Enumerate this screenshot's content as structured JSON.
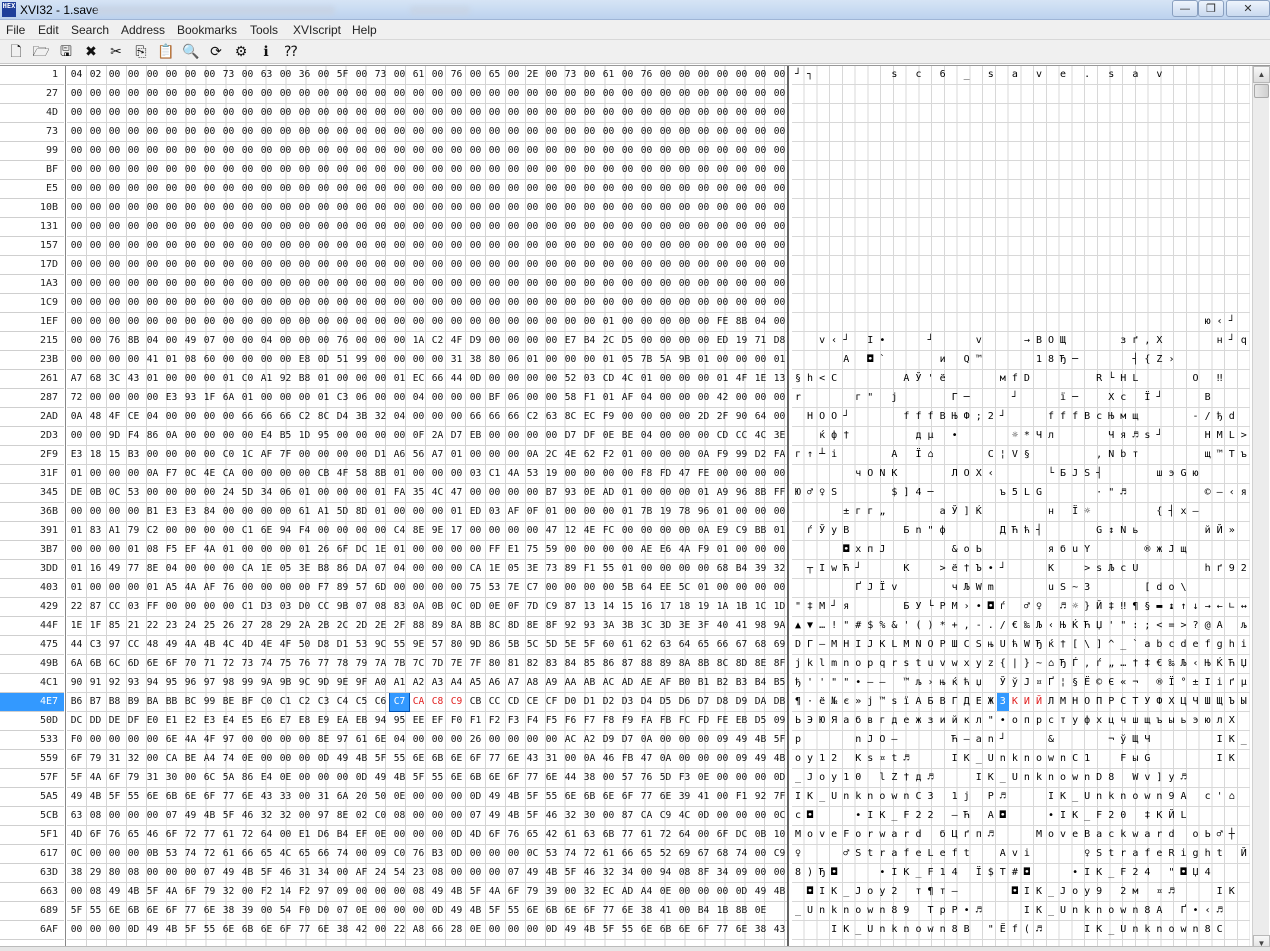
{
  "window": {
    "title": "XVI32 - 1.save",
    "icon_text": "HEX",
    "btn_minimize": "—",
    "btn_maximize": "❐",
    "btn_close": "✕"
  },
  "menu": {
    "items": [
      "File",
      "Edit",
      "Search",
      "Address",
      "Bookmarks",
      "Tools",
      "XVIscript",
      "Help"
    ]
  },
  "toolbar": {
    "buttons": [
      {
        "name": "new-icon",
        "glyph": "🗋"
      },
      {
        "name": "open-icon",
        "glyph": "🗁"
      },
      {
        "name": "save-icon",
        "glyph": "🖫"
      },
      {
        "name": "close-file-icon",
        "glyph": "✖"
      },
      {
        "name": "cut-icon",
        "glyph": "✂"
      },
      {
        "name": "copy-icon",
        "glyph": "⎘"
      },
      {
        "name": "paste-icon",
        "glyph": "📋"
      },
      {
        "name": "find-icon",
        "glyph": "🔍"
      },
      {
        "name": "replace-icon",
        "glyph": "⟳"
      },
      {
        "name": "settings-icon",
        "glyph": "⚙"
      },
      {
        "name": "info-icon",
        "glyph": "ℹ"
      },
      {
        "name": "context-help-icon",
        "glyph": "⁇"
      }
    ]
  },
  "editor": {
    "bytes_per_row": 38,
    "selected_address": "4E7",
    "cursor_col": 17,
    "red_cols": [
      18,
      19,
      20
    ],
    "rows": [
      {
        "addr": "1",
        "hex": "04 02 00 00 00 00 00 00 73 00 63 00 36 00 5F 00 73 00 61 00 76 00 65 00 2E 00 73 00 61 00 76 00 00 00 00 00 00 00",
        "text": "┘┐      s c 6 _ s a v e . s a v        "
      },
      {
        "addr": "27",
        "hex": "00 00 00 00 00 00 00 00 00 00 00 00 00 00 00 00 00 00 00 00 00 00 00 00 00 00 00 00 00 00 00 00 00 00 00 00 00 00",
        "text": ""
      },
      {
        "addr": "4D",
        "hex": "00 00 00 00 00 00 00 00 00 00 00 00 00 00 00 00 00 00 00 00 00 00 00 00 00 00 00 00 00 00 00 00 00 00 00 00 00 00",
        "text": ""
      },
      {
        "addr": "73",
        "hex": "00 00 00 00 00 00 00 00 00 00 00 00 00 00 00 00 00 00 00 00 00 00 00 00 00 00 00 00 00 00 00 00 00 00 00 00 00 00",
        "text": ""
      },
      {
        "addr": "99",
        "hex": "00 00 00 00 00 00 00 00 00 00 00 00 00 00 00 00 00 00 00 00 00 00 00 00 00 00 00 00 00 00 00 00 00 00 00 00 00 00",
        "text": ""
      },
      {
        "addr": "BF",
        "hex": "00 00 00 00 00 00 00 00 00 00 00 00 00 00 00 00 00 00 00 00 00 00 00 00 00 00 00 00 00 00 00 00 00 00 00 00 00 00",
        "text": ""
      },
      {
        "addr": "E5",
        "hex": "00 00 00 00 00 00 00 00 00 00 00 00 00 00 00 00 00 00 00 00 00 00 00 00 00 00 00 00 00 00 00 00 00 00 00 00 00 00",
        "text": ""
      },
      {
        "addr": "10B",
        "hex": "00 00 00 00 00 00 00 00 00 00 00 00 00 00 00 00 00 00 00 00 00 00 00 00 00 00 00 00 00 00 00 00 00 00 00 00 00 00",
        "text": ""
      },
      {
        "addr": "131",
        "hex": "00 00 00 00 00 00 00 00 00 00 00 00 00 00 00 00 00 00 00 00 00 00 00 00 00 00 00 00 00 00 00 00 00 00 00 00 00 00",
        "text": ""
      },
      {
        "addr": "157",
        "hex": "00 00 00 00 00 00 00 00 00 00 00 00 00 00 00 00 00 00 00 00 00 00 00 00 00 00 00 00 00 00 00 00 00 00 00 00 00 00",
        "text": ""
      },
      {
        "addr": "17D",
        "hex": "00 00 00 00 00 00 00 00 00 00 00 00 00 00 00 00 00 00 00 00 00 00 00 00 00 00 00 00 00 00 00 00 00 00 00 00 00 00",
        "text": ""
      },
      {
        "addr": "1A3",
        "hex": "00 00 00 00 00 00 00 00 00 00 00 00 00 00 00 00 00 00 00 00 00 00 00 00 00 00 00 00 00 00 00 00 00 00 00 00 00 00",
        "text": ""
      },
      {
        "addr": "1C9",
        "hex": "00 00 00 00 00 00 00 00 00 00 00 00 00 00 00 00 00 00 00 00 00 00 00 00 00 00 00 00 00 00 00 00 00 00 00 00 00 00",
        "text": ""
      },
      {
        "addr": "1EF",
        "hex": "00 00 00 00 00 00 00 00 00 00 00 00 00 00 00 00 00 00 00 00 00 00 00 00 00 00 00 00 01 00 00 00 00 00 FE 8B 04 00",
        "text": "                                  ю‹┘ "
      },
      {
        "addr": "215",
        "hex": "00 00 76 8B 04 00 49 07 00 00 04 00 00 00 76 00 00 00 1A C2 4F D9 00 00 00 00 E7 B4 2C D5 00 00 00 00 ED 19 71 D8",
        "text": "  v‹┘ I•   ┘   v   →ВОЩ    зґ,Х    н┘qШ"
      },
      {
        "addr": "23B",
        "hex": "00 00 00 00 41 01 08 60 00 00 00 00 E8 0D 51 99 00 00 00 00 31 38 80 06 01 00 00 00 01 05 7B 5A 9B 01 00 00 00 01",
        "text": "    А ◘`    и Q™    18Ђ─    ┤{Z›    "
      },
      {
        "addr": "261",
        "hex": "A7 68 3C 43 01 00 00 00 01 C0 A1 92 B8 01 00 00 00 01 EC 66 44 0D 00 00 00 00 52 03 CD 4C 01 00 00 00 01 4F 1E 13",
        "text": "§h<C     АЎ'ё    мfD     R└HL    О ‼"
      },
      {
        "addr": "287",
        "hex": "72 00 00 00 00 E3 93 1F 6A 01 00 00 00 01 C3 06 00 00 04 00 00 00 BF 06 00 00 58 F1 01 AF 04 00 00 00 42 00 00 00",
        "text": "r    г\" j    Г─   ┘   ї─  Xс Ї┘   В   "
      },
      {
        "addr": "2AD",
        "hex": "0A 48 4F CE 04 00 00 00 00 66 66 66 C2 8C D4 3B 32 04 00 00 00 66 66 66 C2 63 8C EC F9 00 00 00 00 2D 2F 90 64 00",
        "text": " HOО┘    fffВЊФ;2┘   fffВcЊмщ    -/ђd "
      },
      {
        "addr": "2D3",
        "hex": "00 00 9D F4 86 0A 00 00 00 00 E4 B5 1D 95 00 00 00 00 0F 2A D7 EB 00 00 00 00 D7 DF 0E BE 04 00 00 00 CD CC 4C 3E",
        "text": "  ќф†     дµ •    ☼*Чл    Чя♬ѕ┘   НМL>"
      },
      {
        "addr": "2F9",
        "hex": "E3 18 15 B3 00 00 00 00 C0 1C AF 7F 00 00 00 00 D1 A6 56 A7 01 00 00 00 0A 2C 4E 62 F2 01 00 00 00 0A F9 99 D2 FA",
        "text": "г↑┴і    А Ї⌂    С¦V§     ,Nbт     щ™Тъ"
      },
      {
        "addr": "31F",
        "hex": "01 00 00 00 0A F7 0C 4E CA 00 00 00 00 CB 4F 58 8B 01 00 00 00 03 C1 4A 53 19 00 00 00 00 F8 FD 47 FE 00 00 00 00",
        "text": "     чONК    ЛОХ‹    └БJS┤    шэGю    "
      },
      {
        "addr": "345",
        "hex": "DE 0B 0C 53 00 00 00 00 24 5D 34 06 01 00 00 00 01 FA 35 4C 47 00 00 00 00 B7 93 0E AD 01 00 00 00 01 A9 96 8B FF",
        "text": "Ю♂♀S    $]4─     ъ5LG    ·\"♬­     ©–‹я"
      },
      {
        "addr": "36B",
        "hex": "00 00 00 00 B1 E3 E3 84 00 00 00 00 61 A1 5D 8D 01 00 00 00 01 ED 03 AF 0F 01 00 00 00 01 7B 19 78 96 01 00 00 00",
        "text": "    ±гг„    аЎ]Ќ     н Ї☼     {┤x–    "
      },
      {
        "addr": "391",
        "hex": "01 83 A1 79 C2 00 00 00 00 C1 6E 94 F4 00 00 00 00 C4 8E 9E 17 00 00 00 00 47 12 4E FC 00 00 00 00 0A E9 C9 BB 01",
        "text": " ѓЎуВ    Бn\"ф    ДЋћ┤    G↕Nь     йЙ» "
      },
      {
        "addr": "3B7",
        "hex": "00 00 00 01 08 F5 EF 4A 01 00 00 00 01 26 6F DC 1E 01 00 00 00 00 FF E1 75 59 00 00 00 00 AE E6 4A F9 01 00 00 00",
        "text": "    ◘хпJ     &oЬ     ябuY    ®жJщ    "
      },
      {
        "addr": "3DD",
        "hex": "01 16 49 77 8E 04 00 00 00 CA 1E 05 3E B8 86 DA 07 04 00 00 00 CA 1E 05 3E 73 89 F1 55 01 00 00 00 00 68 B4 39 32",
        "text": " ┬IwЋ┘   К  >ё†Ъ•┘   К  >sЉсU     hґ92"
      },
      {
        "addr": "403",
        "hex": "01 00 00 00 01 A5 4A AF 76 00 00 00 00 F7 89 57 6D 00 00 00 00 75 53 7E C7 00 00 00 00 5B 64 EE 5C 01 00 00 00 00",
        "text": "     ҐJЇv    чЉWm    uS~З    [dо\\     "
      },
      {
        "addr": "429",
        "hex": "22 87 CC 03 FF 00 00 00 00 C1 D3 03 D0 CC 9B 07 08 83 0A 0B 0C 0D 0E 0F 7D C9 87 13 14 15 16 17 18 19 1A 1B 1C 1D",
        "text": "\"‡М┘я    БУ└РМ›•◘ѓ ♂♀ ♬☼}Й‡‼¶§▬↨↑↓→←∟↔"
      },
      {
        "addr": "44F",
        "hex": "1E 1F 85 21 22 23 24 25 26 27 28 29 2A 2B 2C 2D 2E 2F 88 89 8A 8B 8C 8D 8E 8F 92 93 3A 3B 3C 3D 3E 3F 40 41 98 9A",
        "text": "▲▼…!\"#$%&'()*+,-./€‰Љ‹ЊЌЋЏ'\":;<=>?@A љ"
      },
      {
        "addr": "475",
        "hex": "44 C3 97 CC 48 49 4A 4B 4C 4D 4E 4F 50 D8 D1 53 9C 55 9E 57 80 9D 86 5B 5C 5D 5E 5F 60 61 62 63 64 65 66 67 68 69",
        "text": "DГ—МHIJKLMNOPШСSњUћWЂќ†[\\]^_`abcdefghi"
      },
      {
        "addr": "49B",
        "hex": "6A 6B 6C 6D 6E 6F 70 71 72 73 74 75 76 77 78 79 7A 7B 7C 7D 7E 7F 80 81 82 83 84 85 86 87 88 89 8A 8B 8C 8D 8E 8F",
        "text": "jklmnopqrstuvwxyz{|}~⌂ЂЃ‚ѓ„…†‡€‰Љ‹ЊЌЋЏ"
      },
      {
        "addr": "4C1",
        "hex": "90 91 92 93 94 95 96 97 98 99 9A 9B 9C 9D 9E 9F A0 A1 A2 A3 A4 A5 A6 A7 A8 A9 AA AB AC AD AE AF B0 B1 B2 B3 B4 B5",
        "text": "ђ''\"\"•–— ™љ›њќћџ ЎўЈ¤Ґ¦§Ё©Є«¬­®Ї°±Ііґµ"
      },
      {
        "addr": "4E7",
        "hex": "B6 B7 B8 B9 BA BB BC 99 BE BF C0 C1 C2 C3 C4 C5 C6 C7 CA C8 C9 CB CC CD CE CF D0 D1 D2 D3 D4 D5 D6 D7 D8 D9 DA DB",
        "text": "¶·ё№є»ј™ѕїАБВГДЕЖЗКИЙЛМНОПРСТУФХЦЧШЩЪЫ"
      },
      {
        "addr": "50D",
        "hex": "DC DD DE DF E0 E1 E2 E3 E4 E5 E6 E7 E8 E9 EA EB 94 95 EE EF F0 F1 F2 F3 F4 F5 F6 F7 F8 F9 FA FB FC FD FE EB D5 09",
        "text": "ЬЭЮЯабвгдежзийкл\"•опрстуфхцчшщъыьэюлХ "
      },
      {
        "addr": "533",
        "hex": "F0 00 00 00 00 6E 4A 4F 97 00 00 00 00 8E 97 61 6E 04 00 00 00 26 00 00 00 00 AC A2 D9 D7 0A 00 00 00 09 49 4B 5F 4A",
        "text": "р    nJO—    Ћ—an┘   &    ¬ўЩЧ     IK_J"
      },
      {
        "addr": "559",
        "hex": "6F 79 31 32 00 CA BE A4 74 0E 00 00 00 0D 49 4B 5F 55 6E 6B 6E 6F 77 6E 43 31 00 0A 46 FB 47 0A 00 00 00 09 49 4B",
        "text": "oy12 Кѕ¤t♬   IK_UnknownC1  FыG     IK"
      },
      {
        "addr": "57F",
        "hex": "5F 4A 6F 79 31 30 00 6C 5A 86 E4 0E 00 00 00 0D 49 4B 5F 55 6E 6B 6E 6F 77 6E 44 38 00 57 76 5D F3 0E 00 00 00 0D",
        "text": "_Joy10 lZ†д♬   IK_UnknownD8 Wv]у♬   "
      },
      {
        "addr": "5A5",
        "hex": "49 4B 5F 55 6E 6B 6E 6F 77 6E 43 33 00 31 6A 20 50 0E 00 00 00 0D 49 4B 5F 55 6E 6B 6E 6F 77 6E 39 41 00 F1 92 7F",
        "text": "IK_UnknownC3 1j P♬   IK_Unknown9A с'⌂"
      },
      {
        "addr": "5CB",
        "hex": "63 08 00 00 00 07 49 4B 5F 46 32 32 00 97 8E 02 C0 08 00 00 00 07 49 4B 5F 46 32 30 00 87 CA C9 4C 0D 00 00 00 0C",
        "text": "c◘   •IK_F22 —Ћ А◘   •IK_F20 ‡КЙL    "
      },
      {
        "addr": "5F1",
        "hex": "4D 6F 76 65 46 6F 72 77 61 72 64 00 E1 D6 B4 EF 0E 00 00 00 0D 4D 6F 76 65 42 61 63 6B 77 61 72 64 00 6F DC 0B 10",
        "text": "MoveForward бЦґп♬   MoveBackward oЬ♂┼"
      },
      {
        "addr": "617",
        "hex": "0C 00 00 00 0B 53 74 72 61 66 65 4C 65 66 74 00 09 C0 76 B3 0D 00 00 00 0C 53 74 72 61 66 65 52 69 67 68 74 00 C9",
        "text": "♀   ♂StrafeLeft  Avi    ♀StrafeRight Й"
      },
      {
        "addr": "63D",
        "hex": "38 29 80 08 00 00 00 07 49 4B 5F 46 31 34 00 AF 24 54 23 08 00 00 00 07 49 4B 5F 46 32 34 00 94 08 8F 34 09 00 00",
        "text": "8)Ђ◘   •IK_F14 Ї$T#◘   •IK_F24 \"◘Џ4  "
      },
      {
        "addr": "663",
        "hex": "00 08 49 4B 5F 4A 6F 79 32 00 F2 14 F2 97 09 00 00 00 08 49 4B 5F 4A 6F 79 39 00 32 EC AD A4 0E 00 00 00 0D 49 4B",
        "text": " ◘IK_Joy2 т¶т—    ◘IK_Joy9 2м­¤♬   IK"
      },
      {
        "addr": "689",
        "hex": "5F 55 6E 6B 6E 6F 77 6E 38 39 00 54 F0 D0 07 0E 00 00 00 0D 49 4B 5F 55 6E 6B 6E 6F 77 6E 38 41 00 B4 1B 8B 0E",
        "text": "_Unknown89 TpР•♬   IK_Unknown8A Ґ•‹♬"
      },
      {
        "addr": "6AF",
        "hex": "00 00 00 0D 49 4B 5F 55 6E 6B 6E 6F 77 6E 38 42 00 22 A8 66 28 0E 00 00 00 0D 49 4B 5F 55 6E 6B 6E 6F 77 6E 38 43",
        "text": "   IK_Unknown8B \"Ёf(♬   IK_Unknown8C"
      }
    ]
  }
}
